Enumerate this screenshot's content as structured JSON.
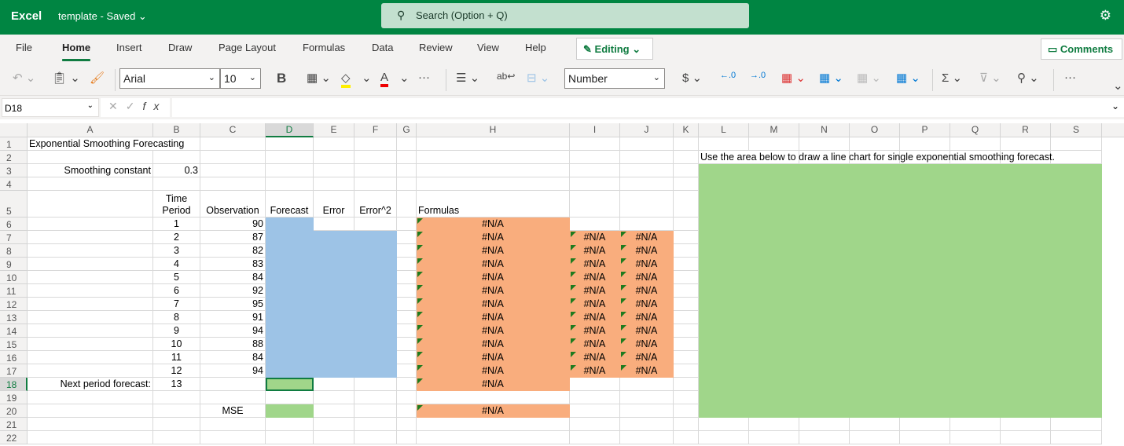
{
  "titlebar": {
    "app": "Excel",
    "document": "template",
    "status": "Saved",
    "search_placeholder": "Search (Option + Q)"
  },
  "menu": {
    "tabs": [
      "File",
      "Home",
      "Insert",
      "Draw",
      "Page Layout",
      "Formulas",
      "Data",
      "Review",
      "View",
      "Help"
    ],
    "active": "Home",
    "editing": "Editing",
    "comments": "Comments"
  },
  "ribbon": {
    "font": "Arial",
    "font_size": "10",
    "number_format": "Number",
    "bold": "B"
  },
  "formula_bar": {
    "name_box": "D18",
    "formula": ""
  },
  "colors": {
    "accent": "#107c41",
    "blue_fill": "#9dc3e6",
    "orange_fill": "#f9ad7d",
    "green_fill": "#a0d68a"
  },
  "sheet": {
    "columns": [
      "A",
      "B",
      "C",
      "D",
      "E",
      "F",
      "G",
      "H",
      "I",
      "J",
      "K",
      "L",
      "M",
      "N",
      "O",
      "P",
      "Q",
      "R",
      "S"
    ],
    "rows": [
      "1",
      "2",
      "3",
      "4",
      "5",
      "6",
      "7",
      "8",
      "9",
      "10",
      "11",
      "12",
      "13",
      "14",
      "15",
      "16",
      "17",
      "18",
      "19",
      "20",
      "21",
      "22"
    ],
    "selected_cell": "D18",
    "cells": {
      "A1": "Exponential Smoothing Forecasting",
      "L2": "Use the area below to draw a line chart for single exponential smoothing forecast.",
      "A3": "Smoothing constant",
      "B3": "0.3",
      "B5": "Time Period",
      "C5": "Observation",
      "D5": "Forecast",
      "E5": "Error",
      "F5": "Error^2",
      "H5": "Formulas",
      "B6": "1",
      "C6": "90",
      "H6": "#N/A",
      "B7": "2",
      "C7": "87",
      "H7": "#N/A",
      "I7": "#N/A",
      "J7": "#N/A",
      "B8": "3",
      "C8": "82",
      "H8": "#N/A",
      "I8": "#N/A",
      "J8": "#N/A",
      "B9": "4",
      "C9": "83",
      "H9": "#N/A",
      "I9": "#N/A",
      "J9": "#N/A",
      "B10": "5",
      "C10": "84",
      "H10": "#N/A",
      "I10": "#N/A",
      "J10": "#N/A",
      "B11": "6",
      "C11": "92",
      "H11": "#N/A",
      "I11": "#N/A",
      "J11": "#N/A",
      "B12": "7",
      "C12": "95",
      "H12": "#N/A",
      "I12": "#N/A",
      "J12": "#N/A",
      "B13": "8",
      "C13": "91",
      "H13": "#N/A",
      "I13": "#N/A",
      "J13": "#N/A",
      "B14": "9",
      "C14": "94",
      "H14": "#N/A",
      "I14": "#N/A",
      "J14": "#N/A",
      "B15": "10",
      "C15": "88",
      "H15": "#N/A",
      "I15": "#N/A",
      "J15": "#N/A",
      "B16": "11",
      "C16": "84",
      "H16": "#N/A",
      "I16": "#N/A",
      "J16": "#N/A",
      "B17": "12",
      "C17": "94",
      "H17": "#N/A",
      "I17": "#N/A",
      "J17": "#N/A",
      "A18": "Next period forecast:",
      "B18": "13",
      "H18": "#N/A",
      "C20": "MSE",
      "H20": "#N/A"
    }
  }
}
